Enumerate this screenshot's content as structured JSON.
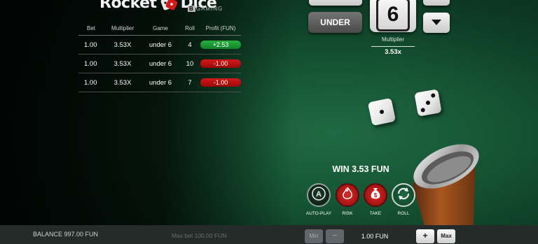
{
  "logo": {
    "word1": "Rocket",
    "word2": "Dice",
    "sub_brand_prefix": "B",
    "sub_brand": "GAMING"
  },
  "history": {
    "headers": {
      "bet": "Bet",
      "multiplier": "Multiplier",
      "game": "Game",
      "roll": "Roll",
      "profit": "Profit (FUN)"
    },
    "rows": [
      {
        "bet": "1.00",
        "multiplier": "3.53X",
        "game": "under 6",
        "roll": "4",
        "profit": "+2.53",
        "result": "win"
      },
      {
        "bet": "1.00",
        "multiplier": "3.53X",
        "game": "under 6",
        "roll": "10",
        "profit": "-1.00",
        "result": "loss"
      },
      {
        "bet": "1.00",
        "multiplier": "3.53X",
        "game": "under 6",
        "roll": "7",
        "profit": "-1.00",
        "result": "loss"
      }
    ]
  },
  "controls": {
    "mode_label": "UNDER",
    "target_number": "6",
    "multiplier_label": "Multiplier",
    "multiplier_value": "3.53x"
  },
  "dice": {
    "die1": 1,
    "die2": 3
  },
  "win_text": "WIN 3.53 FUN",
  "actions": [
    {
      "label": "AUTO-PLAY",
      "icon": "autoplay-icon"
    },
    {
      "label": "RISK",
      "icon": "flame-icon"
    },
    {
      "label": "TAKE",
      "icon": "money-bag-icon"
    },
    {
      "label": "ROLL",
      "icon": "roll-icon"
    }
  ],
  "bottom": {
    "balance": "BALANCE 997.00 FUN",
    "max_bet": "Max bet 100.00 FUN",
    "min_label": "Min",
    "minus_label": "−",
    "bet_value": "1.00 FUN",
    "plus_label": "+",
    "max_label": "Max"
  },
  "colors": {
    "felt": "#165534",
    "win": "#1e9a34",
    "loss": "#c21212"
  }
}
